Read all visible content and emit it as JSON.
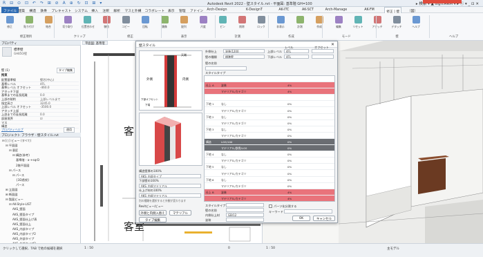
{
  "app": {
    "title": "Autodesk Revit 2022 - 壁スタイル.rvt - 平面図: 基準階 GH=100",
    "right": "▸ 検索 ▾  ▲ sign.ARM ▾  ▸ ⓘ ▾  _ ⊡ ✕",
    "quick_access": "R ⊟ ⊙ ⊡ ↶ ↷ ⊞ ⊘ A ⊕ ↻ ⊡ ⊞ ▾"
  },
  "tabs": [
    "ファイル",
    "建築",
    "構造",
    "鉄骨",
    "プレキャスト",
    "システム",
    "挿入",
    "注釈",
    "解析",
    "マスと外構",
    "コラボレート",
    "表示",
    "管理",
    "アドイン",
    "Arch-Design",
    "K-DesignT",
    "AK-ITC",
    "AK-SCT",
    "Arch-Manage",
    "AK-FM",
    "修正 | 壁",
    "（図）"
  ],
  "active_tab": "修正 | 壁",
  "ribbon": {
    "groups": [
      "修正項目",
      "クリップ",
      "修正",
      "表示",
      "計測",
      "作成",
      "モード",
      "壁",
      "ヘルプ"
    ],
    "buttons": [
      "修正",
      "貼り付け",
      "結合",
      "切り取り",
      "位置合わせ",
      "移動",
      "コピー",
      "回転",
      "鏡像",
      "配列",
      "尺度",
      "ピン",
      "削除",
      "ロック",
      "非表示",
      "計測",
      "作成",
      "編集",
      "リセット",
      "アタッチ",
      "デタッチ",
      "ヘルプ"
    ]
  },
  "left_panel": {
    "properties_header": "プロパティ",
    "type_name": "標準壁",
    "type_sub": "GH850/壁",
    "wall_selector": "壁 (1)",
    "edit_type": "タイプ編集",
    "section": "拘束",
    "rows": [
      {
        "k": "配置基準線",
        "v": "壁芯(中心)"
      },
      {
        "k": "基準レベル",
        "v": "4FL"
      },
      {
        "k": "基準レベル オフセット",
        "v": "-460.0"
      },
      {
        "k": "アタッチ下部",
        "v": ""
      },
      {
        "k": "基準までの延長距離",
        "v": "0.0"
      },
      {
        "k": "上部の制約",
        "v": "上部レベルまで"
      },
      {
        "k": "指定高さ",
        "v": "3245.0"
      },
      {
        "k": "上部レベル オフセット",
        "v": "-3500.0"
      },
      {
        "k": "アタッチ上部",
        "v": ""
      },
      {
        "k": "上部までの延長距離",
        "v": "0.0"
      },
      {
        "k": "部屋境界",
        "v": "☑"
      },
      {
        "k": "マス",
        "v": ""
      },
      {
        "k": "構造",
        "v": ""
      }
    ],
    "help_link": "プロパティヘルプ",
    "apply": "適用",
    "browser_header": "プロジェクト ブラウザ - 壁スタイル.rvt",
    "tree": [
      {
        "indent": 0,
        "label": "⊟ [○] ビュー (すべて)"
      },
      {
        "indent": 1,
        "label": "⊟ 平面図"
      },
      {
        "indent": 2,
        "label": "⊟ 意匠"
      },
      {
        "indent": 3,
        "label": "⊟ 構造(参考)"
      },
      {
        "indent": 4,
        "label": "基準階 - a-+sqrD"
      },
      {
        "indent": 4,
        "label": "2階平面図"
      },
      {
        "indent": 2,
        "label": "⊟ パース"
      },
      {
        "indent": 3,
        "label": "⊟ パース"
      },
      {
        "indent": 4,
        "label": "{3D透視}"
      },
      {
        "indent": 4,
        "label": "パース"
      },
      {
        "indent": 1,
        "label": "⊞ 立面図"
      },
      {
        "indent": 1,
        "label": "⊞ 断面図"
      },
      {
        "indent": 1,
        "label": "⊟ 製図ビュー"
      },
      {
        "indent": 2,
        "label": "⊟ AK-Style-LIST"
      },
      {
        "indent": 3,
        "label": "AKS_壁面"
      },
      {
        "indent": 3,
        "label": "AKS_壁面タイプ"
      },
      {
        "indent": 3,
        "label": "AKS_壁面仕上げ表"
      },
      {
        "indent": 3,
        "label": "AKS_壁面仕上"
      },
      {
        "indent": 3,
        "label": "AKS_内部タイプ"
      },
      {
        "indent": 3,
        "label": "AKS_内部タイプ2"
      },
      {
        "indent": 3,
        "label": "AKS_外部タイプ"
      },
      {
        "indent": 3,
        "label": "AKS_外部タイプ2"
      }
    ]
  },
  "views": {
    "plan_tab": "平面図: 基準階",
    "room_label_1": "客",
    "room_label_2": "客室",
    "scale": "1 : 50",
    "view2_tab": "{3D}",
    "scale2": "1 : 50"
  },
  "status": {
    "left": "クリックして選択、TAB で他の候補を選択",
    "middle": "0",
    "right": "主モデル"
  },
  "dialog": {
    "title": "壁スタイル",
    "close": "✕",
    "preview_labels": {
      "top": "天端",
      "exterior": "外側",
      "interior": "内側",
      "bottom_a": "下部オフセット",
      "bottom_b": "下端"
    },
    "fields": [
      {
        "label": "外側仕上",
        "value": "塗装/1200"
      },
      {
        "label": "壁の種類",
        "value": "標準壁"
      },
      {
        "label": "上部レベル",
        "value": "4FL"
      },
      {
        "label": "下部レベル",
        "value": "4FL"
      }
    ],
    "col_header_level": "レベル",
    "col_header_offset": "オフセット",
    "name_label": "壁の名前",
    "style_label": "スタイルタイプ",
    "left_labels": [
      "構造壁厚の100%",
      "AKS_内部タイプ",
      "下部壁の100%",
      "AKS_内部マテリアル",
      "仕上げ材の100%",
      "AKS_内部マテリアル"
    ],
    "note": "別の種類を選択すると外観が変わります",
    "align_label": "Revitビュー/ビュー",
    "button_swap": "外側と内側入替え",
    "button_material": "マテリアル",
    "button_type_edit": "タイプ編集",
    "layers": [
      {
        "group": "",
        "name": "",
        "cls": "",
        "val": ""
      },
      {
        "group": "仕上 A",
        "name": "塗装",
        "cls": "red",
        "val": "4%"
      },
      {
        "group": "",
        "name": "マテリアル/カテゴリ",
        "cls": "red",
        "val": "4%"
      },
      {
        "group": "",
        "name": "",
        "cls": "",
        "val": ""
      },
      {
        "group": "下地 1",
        "name": "なし",
        "cls": "",
        "val": "0%"
      },
      {
        "group": "",
        "name": "マテリアル/カテゴリ",
        "cls": "",
        "val": "0%"
      },
      {
        "group": "下地 2",
        "name": "なし",
        "cls": "",
        "val": "0%"
      },
      {
        "group": "",
        "name": "マテリアル/カテゴリ",
        "cls": "",
        "val": "0%"
      },
      {
        "group": "下地 3",
        "name": "なし",
        "cls": "",
        "val": "0%"
      },
      {
        "group": "",
        "name": "マテリアル/カテゴリ",
        "cls": "",
        "val": "0%"
      },
      {
        "group": "構造",
        "name": "LGS/100",
        "cls": "dark",
        "val": "0%"
      },
      {
        "group": "",
        "name": "マテリアル/鉄骨/LGS",
        "cls": "dark",
        "val": "0%"
      },
      {
        "group": "下地 4",
        "name": "なし",
        "cls": "",
        "val": "0%"
      },
      {
        "group": "",
        "name": "マテリアル/カテゴリ",
        "cls": "",
        "val": "0%"
      },
      {
        "group": "下地 5",
        "name": "なし",
        "cls": "",
        "val": "0%"
      },
      {
        "group": "",
        "name": "マテリアル/カテゴリ",
        "cls": "",
        "val": "0%"
      },
      {
        "group": "下地 6",
        "name": "なし",
        "cls": "",
        "val": "0%"
      },
      {
        "group": "",
        "name": "マテリアル/カテゴリ",
        "cls": "",
        "val": "0%"
      },
      {
        "group": "仕上 B",
        "name": "塗装",
        "cls": "red",
        "val": "4%"
      },
      {
        "group": "",
        "name": "マテリアル/カテゴリ",
        "cls": "red",
        "val": "4%"
      }
    ],
    "bottom_fields": [
      {
        "label": "スタイルタイプ",
        "value": ""
      },
      {
        "label": "壁の名前",
        "value": ""
      },
      {
        "label": "内側仕上材",
        "value": "GB/12"
      },
      {
        "label": "塗装",
        "value": ""
      }
    ],
    "checkbox_label": "パーツ化分割する",
    "keyword_label": "キーワード",
    "ok": "OK",
    "cancel": "キャンセル"
  },
  "colors": {
    "accent": "#2e6bb3",
    "layer_red": "#e9737b",
    "layer_dark": "#6a6d72",
    "brand_red": "#e04b3c"
  }
}
